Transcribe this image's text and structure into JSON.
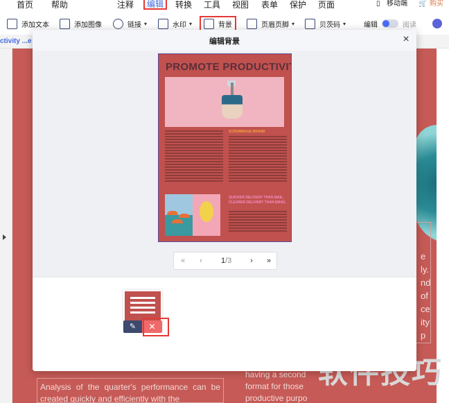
{
  "menu": {
    "items": [
      "首页",
      "帮助",
      "注释",
      "编辑",
      "转换",
      "工具",
      "视图",
      "表单",
      "保护",
      "页面"
    ],
    "active": "编辑",
    "mobile": "移动端",
    "buy": "购买"
  },
  "toolbar": {
    "add_text": "添加文本",
    "add_image": "添加图像",
    "link": "链接",
    "watermark": "水印",
    "background": "背景",
    "header_footer": "页眉页脚",
    "bates": "贝茨码",
    "edit": "编辑",
    "read": "阅读"
  },
  "doc_tab": "ctivity ...e",
  "background_doc": {
    "right_letters": [
      "e",
      "ly.",
      "nd",
      "of",
      "ce",
      "ity",
      "p"
    ],
    "left_text": "Analysis of the quarter's performance can be created quickly and efficiently with the",
    "right_text": "having a second format for those productive purpo"
  },
  "watermark_text": "软件技巧",
  "dialog": {
    "title": "编辑背景",
    "close": "×",
    "preview": {
      "title": "PROMOTE PRODUCTIVITY",
      "orange_heading": "SCRUMMAGE BRAND",
      "pink_heading": "QUICKER DELIVERY THAN MAIL, CLEARER DELIVERY THAN EMAIL"
    },
    "pager": {
      "first": "«",
      "prev": "‹",
      "current": "1",
      "total": "/3",
      "next": "›",
      "last": "»"
    },
    "actions": {
      "edit_icon": "✎",
      "delete_icon": "✕"
    }
  },
  "colors": {
    "accent": "#4169e1",
    "highlight": "#e53935",
    "page_bg": "#c65a56",
    "delete": "#ef6a6a",
    "edit": "#3d4a6e"
  }
}
